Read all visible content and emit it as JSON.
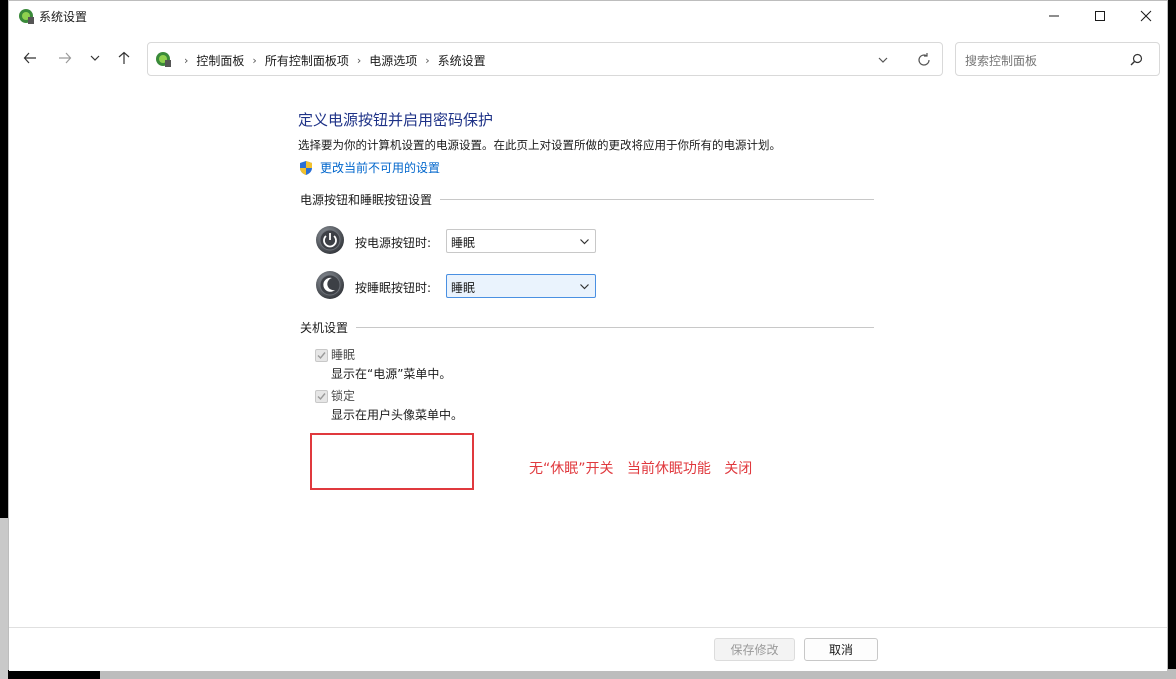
{
  "window": {
    "title": "系统设置",
    "controls": {
      "minimize": "minimize-icon",
      "maximize": "maximize-icon",
      "close": "close-icon"
    }
  },
  "navigation": {
    "breadcrumbs": [
      "控制面板",
      "所有控制面板项",
      "电源选项",
      "系统设置"
    ],
    "search_placeholder": "搜索控制面板"
  },
  "main": {
    "title": "定义电源按钮并启用密码保护",
    "description": "选择要为你的计算机设置的电源设置。在此页上对设置所做的更改将应用于你所有的电源计划。",
    "change_link": "更改当前不可用的设置",
    "buttons_section": {
      "heading": "电源按钮和睡眠按钮设置",
      "power_button": {
        "label": "按电源按钮时:",
        "value": "睡眠"
      },
      "sleep_button": {
        "label": "按睡眠按钮时:",
        "value": "睡眠"
      }
    },
    "shutdown_section": {
      "heading": "关机设置",
      "options": [
        {
          "label": "睡眠",
          "description": "显示在“电源”菜单中。",
          "checked": true,
          "disabled": true
        },
        {
          "label": "锁定",
          "description": "显示在用户头像菜单中。",
          "checked": true,
          "disabled": true
        }
      ]
    },
    "annotation": "无“休眠”开关   当前休眠功能   关闭"
  },
  "footer": {
    "save_label": "保存修改",
    "cancel_label": "取消"
  },
  "colors": {
    "title_blue": "#1e3287",
    "link_blue": "#0066cc",
    "annotation_red": "#e0393e"
  }
}
